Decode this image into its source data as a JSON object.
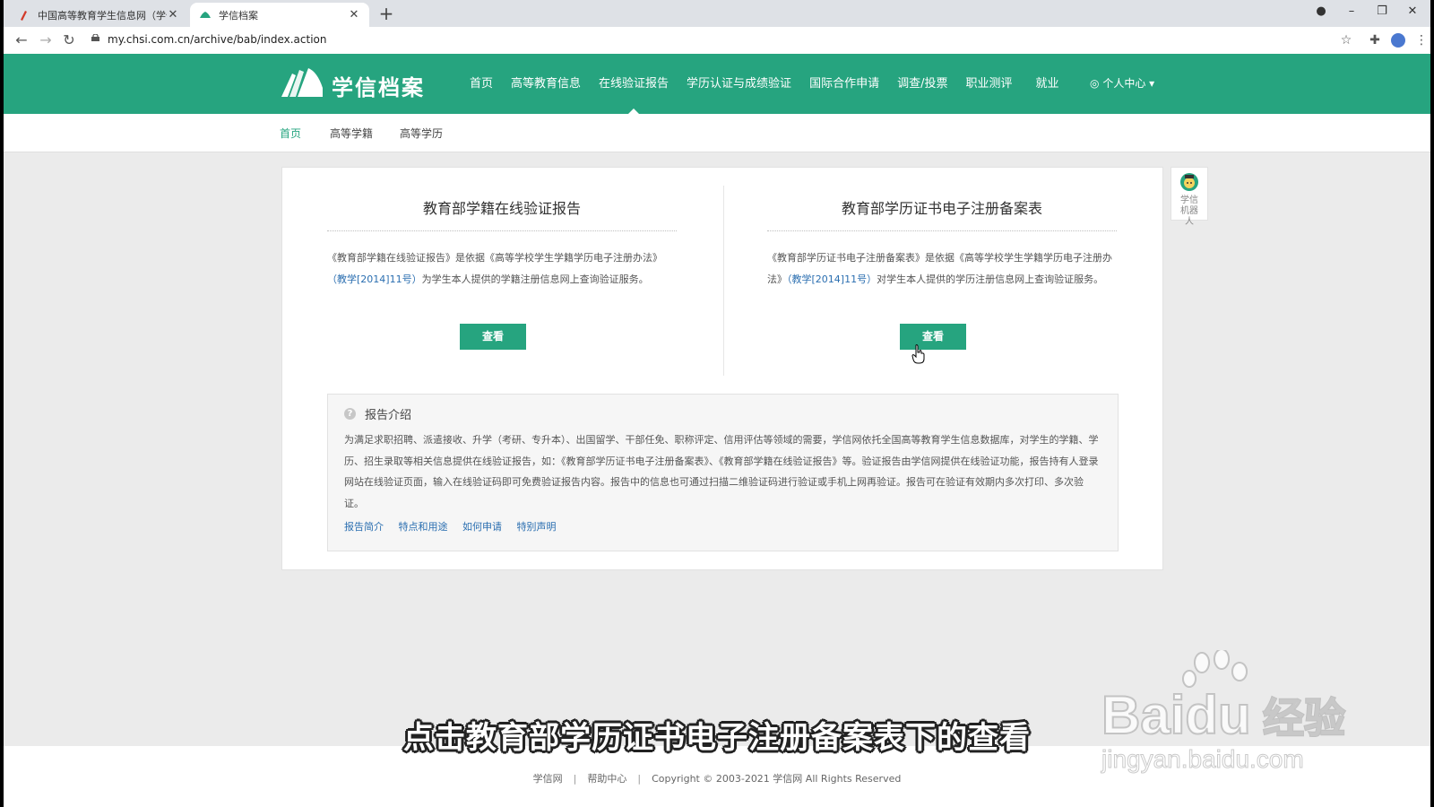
{
  "browser": {
    "tabs": [
      {
        "title": "中国高等教育学生信息网（学信网",
        "active": false
      },
      {
        "title": "学信档案",
        "active": true
      }
    ],
    "url": "my.chsi.com.cn/archive/bab/index.action"
  },
  "site": {
    "logo_text": "学信档案",
    "nav": [
      "首页",
      "高等教育信息",
      "在线验证报告",
      "学历认证与成绩验证",
      "国际合作申请",
      "调查/投票",
      "职业测评",
      "就业"
    ],
    "nav_active": "在线验证报告",
    "user_center": "个人中心",
    "subnav": [
      "首页",
      "高等学籍",
      "高等学历"
    ]
  },
  "left_col": {
    "title": "教育部学籍在线验证报告",
    "desc_pre": "《教育部学籍在线验证报告》是依据《高等学校学生学籍学历电子注册办法》",
    "desc_link": "（教学[2014]11号）",
    "desc_post": "为学生本人提供的学籍注册信息网上查询验证服务。",
    "button": "查看"
  },
  "right_col": {
    "title": "教育部学历证书电子注册备案表",
    "desc_pre": "《教育部学历证书电子注册备案表》是依据《高等学校学生学籍学历电子注册办法》",
    "desc_link": "（教学[2014]11号）",
    "desc_post": "对学生本人提供的学历注册信息网上查询验证服务。",
    "button": "查看"
  },
  "intro": {
    "title": "报告介绍",
    "text": "为满足求职招聘、派遣接收、升学（考研、专升本）、出国留学、干部任免、职称评定、信用评估等领域的需要，学信网依托全国高等教育学生信息数据库，对学生的学籍、学历、招生录取等相关信息提供在线验证报告，如：《教育部学历证书电子注册备案表》、《教育部学籍在线验证报告》等。验证报告由学信网提供在线验证功能，报告持有人登录网站在线验证页面，输入在线验证码即可免费验证报告内容。报告中的信息也可通过扫描二维验证码进行验证或手机上网再验证。报告可在验证有效期内多次打印、多次验证。",
    "links": [
      "报告简介",
      "特点和用途",
      "如何申请",
      "特别声明"
    ]
  },
  "robot_label": "学信机器人",
  "caption": "点击教育部学历证书电子注册备案表下的查看",
  "footer": {
    "link1": "学信网",
    "link2": "帮助中心",
    "copyright": "Copyright © 2003-2021 学信网 All Rights Reserved"
  },
  "watermark": {
    "brand": "Bai",
    "brand2": "du",
    "cn": "经验",
    "url": "jingyan.baidu.com"
  },
  "colors": {
    "brand": "#26a47f",
    "link": "#2a6eb0"
  }
}
